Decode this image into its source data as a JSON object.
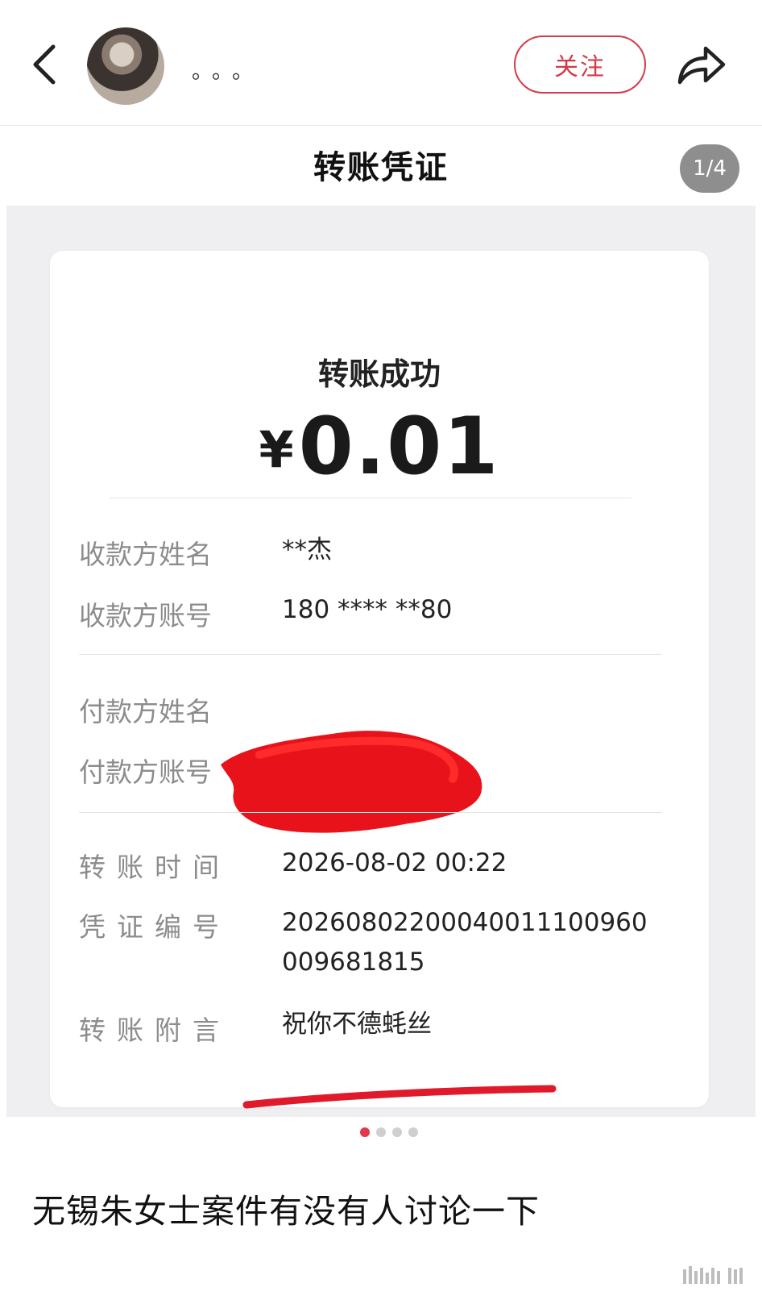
{
  "header": {
    "username": "。。。",
    "follow_label": "关注",
    "icons": [
      "back-icon",
      "share-icon"
    ],
    "accent_color": "#d23b48"
  },
  "title_bar": {
    "title": "转账凭证",
    "page_counter": "1/4"
  },
  "receipt": {
    "status": "转账成功",
    "currency": "¥",
    "amount": "0.01",
    "payee_name_label": "收款方姓名",
    "payee_name": "**杰",
    "payee_account_label": "收款方账号",
    "payee_account": "180 **** **80",
    "payer_name_label": "付款方姓名",
    "payer_account_label": "付款方账号",
    "time_label": "转账时间",
    "time": "2026-08-02 00:22",
    "voucher_label": "凭证编号",
    "voucher_line1": "20260802200040011100960",
    "voucher_line2": "009681815",
    "note_label": "转账附言",
    "note": "祝你不德蚝丝"
  },
  "carousel": {
    "total": 4,
    "active": 1
  },
  "post": {
    "title": "无锡朱女士案件有没有人讨论一下"
  }
}
